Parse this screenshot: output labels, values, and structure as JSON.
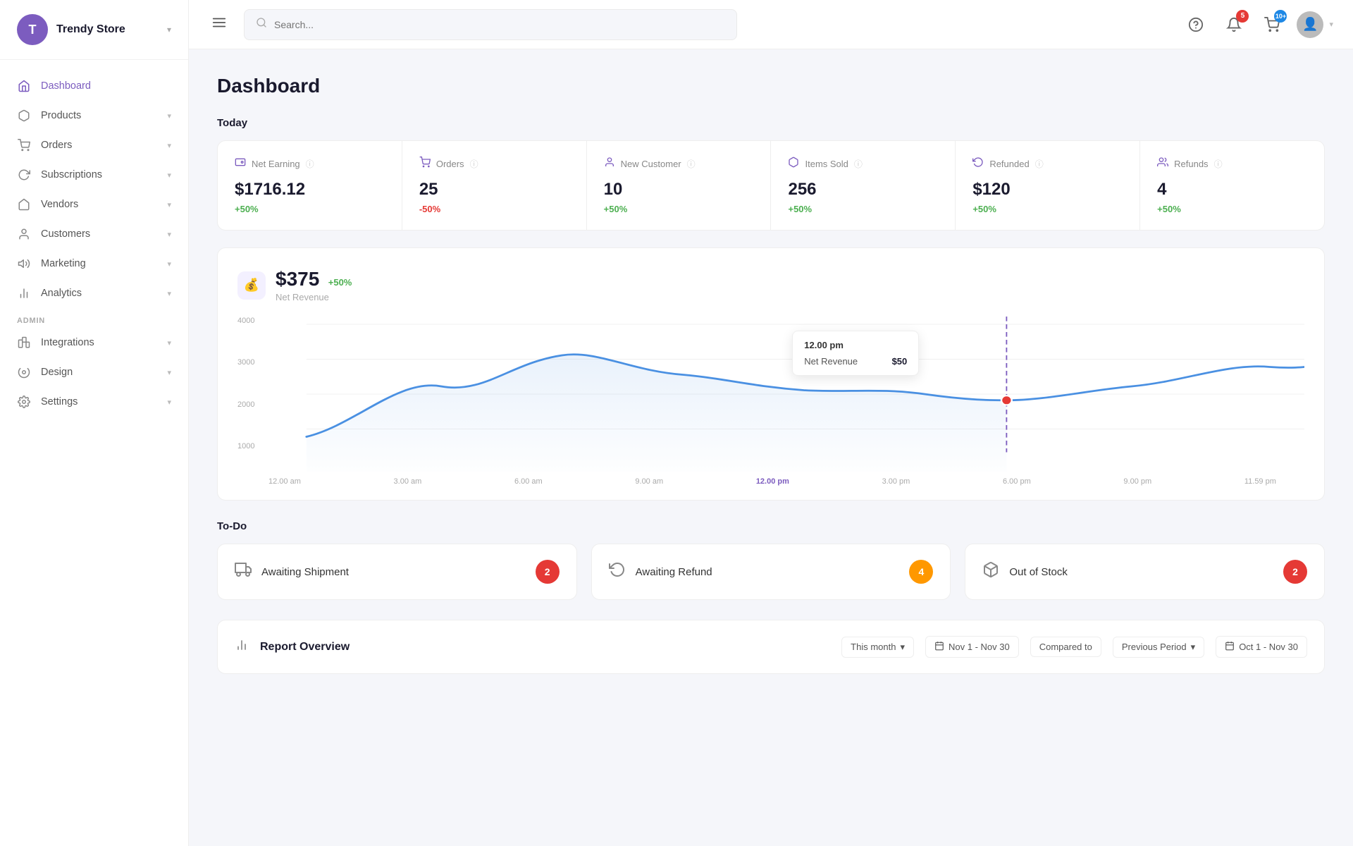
{
  "brand": {
    "initial": "T",
    "name": "Trendy Store"
  },
  "sidebar": {
    "nav_items": [
      {
        "id": "dashboard",
        "label": "Dashboard",
        "icon": "🏠",
        "active": true,
        "has_chevron": false
      },
      {
        "id": "products",
        "label": "Products",
        "icon": "📦",
        "active": false,
        "has_chevron": true
      },
      {
        "id": "orders",
        "label": "Orders",
        "icon": "🛒",
        "active": false,
        "has_chevron": true
      },
      {
        "id": "subscriptions",
        "label": "Subscriptions",
        "icon": "🔄",
        "active": false,
        "has_chevron": true
      },
      {
        "id": "vendors",
        "label": "Vendors",
        "icon": "🏪",
        "active": false,
        "has_chevron": true
      },
      {
        "id": "customers",
        "label": "Customers",
        "icon": "👤",
        "active": false,
        "has_chevron": true
      },
      {
        "id": "marketing",
        "label": "Marketing",
        "icon": "📣",
        "active": false,
        "has_chevron": true
      },
      {
        "id": "analytics",
        "label": "Analytics",
        "icon": "📊",
        "active": false,
        "has_chevron": true
      }
    ],
    "admin_section_label": "Admin",
    "admin_items": [
      {
        "id": "integrations",
        "label": "Integrations",
        "icon": "🔗",
        "has_chevron": true
      },
      {
        "id": "design",
        "label": "Design",
        "icon": "🎨",
        "has_chevron": true
      },
      {
        "id": "settings",
        "label": "Settings",
        "icon": "⚙️",
        "has_chevron": true
      }
    ]
  },
  "topbar": {
    "search_placeholder": "Search...",
    "notification_count": "5",
    "cart_count": "10+"
  },
  "page": {
    "title": "Dashboard"
  },
  "today": {
    "label": "Today",
    "stats": [
      {
        "id": "net-earning",
        "icon": "💳",
        "label": "Net Earning",
        "value": "$1716.12",
        "change": "+50%",
        "positive": true
      },
      {
        "id": "orders",
        "icon": "🛒",
        "label": "Orders",
        "value": "25",
        "change": "-50%",
        "positive": false
      },
      {
        "id": "new-customer",
        "icon": "👤",
        "label": "New Customer",
        "value": "10",
        "change": "+50%",
        "positive": true
      },
      {
        "id": "items-sold",
        "icon": "📦",
        "label": "Items Sold",
        "value": "256",
        "change": "+50%",
        "positive": true
      },
      {
        "id": "refunded",
        "icon": "↩️",
        "label": "Refunded",
        "value": "$120",
        "change": "+50%",
        "positive": true
      },
      {
        "id": "refunds",
        "icon": "👥",
        "label": "Refunds",
        "value": "4",
        "change": "+50%",
        "positive": true
      }
    ]
  },
  "chart": {
    "icon": "💰",
    "value": "$375",
    "change": "+50%",
    "subtitle": "Net Revenue",
    "tooltip_time": "12.00 pm",
    "tooltip_label": "Net Revenue",
    "tooltip_value": "$50",
    "y_labels": [
      "4000",
      "3000",
      "2000",
      "1000"
    ],
    "x_labels": [
      "12.00 am",
      "3.00 am",
      "6.00 am",
      "9.00 am",
      "12.00 pm",
      "3.00 pm",
      "6.00 pm",
      "9.00 pm",
      "11.59 pm"
    ]
  },
  "todo": {
    "label": "To-Do",
    "items": [
      {
        "id": "awaiting-shipment",
        "icon": "🚚",
        "label": "Awaiting Shipment",
        "count": "2",
        "color": "red"
      },
      {
        "id": "awaiting-refund",
        "icon": "🔄",
        "label": "Awaiting Refund",
        "count": "4",
        "color": "yellow"
      },
      {
        "id": "out-of-stock",
        "icon": "📦",
        "label": "Out of Stock",
        "count": "2",
        "color": "red"
      }
    ]
  },
  "report": {
    "title": "Report Overview",
    "period_this_month": "This month",
    "period_custom": "Nov 1 - Nov 30",
    "period_compared": "Compared to",
    "period_previous": "Previous Period",
    "period_prev_dates": "Oct 1 - Nov 30"
  }
}
